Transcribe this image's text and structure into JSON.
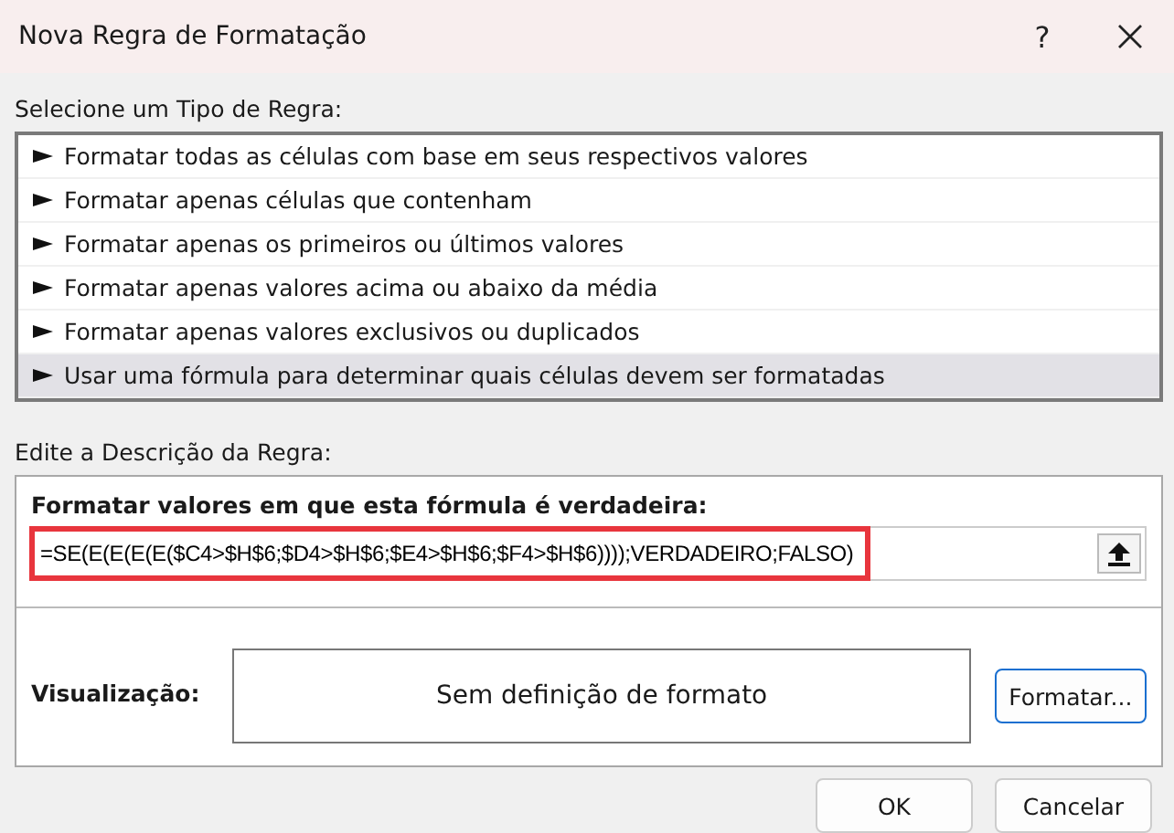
{
  "window": {
    "title": "Nova Regra de Formatação",
    "help": "?"
  },
  "rule_type": {
    "label": "Selecione um Tipo de Regra:",
    "items": [
      {
        "label": "Formatar todas as células com base em seus respectivos valores",
        "selected": false
      },
      {
        "label": "Formatar apenas células que contenham",
        "selected": false
      },
      {
        "label": "Formatar apenas os primeiros ou últimos valores",
        "selected": false
      },
      {
        "label": "Formatar apenas valores acima ou abaixo da média",
        "selected": false
      },
      {
        "label": "Formatar apenas valores exclusivos ou duplicados",
        "selected": false
      },
      {
        "label": "Usar uma fórmula para determinar quais células devem ser formatadas",
        "selected": true
      }
    ]
  },
  "description": {
    "label": "Edite a Descrição da Regra:",
    "formula_label": "Formatar valores em que esta fórmula é verdadeira:",
    "formula": "=SE(E(E(E(E($C4>$H$6;$D4>$H$6;$E4>$H$6;$F4>$H$6))));VERDADEIRO;FALSO)",
    "highlighted": true,
    "preview_label": "Visualização:",
    "preview_text": "Sem definição de formato",
    "format_button": "Formatar..."
  },
  "buttons": [
    "OK",
    "Cancelar"
  ]
}
